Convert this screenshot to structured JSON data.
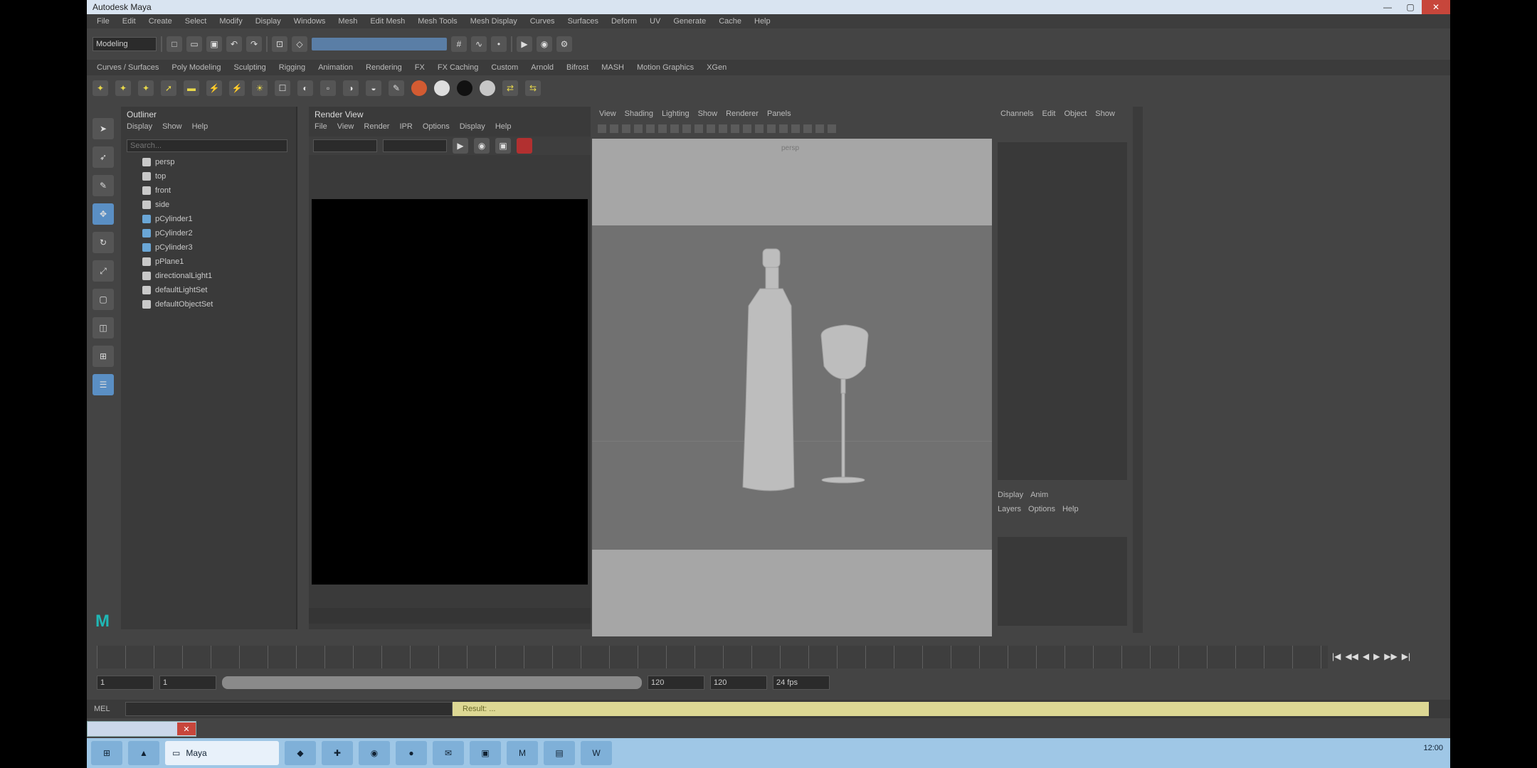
{
  "app": {
    "title": "Autodesk Maya",
    "title_bar_buttons": [
      "—",
      "▢",
      "✕"
    ]
  },
  "status_line": {
    "menus": [
      "File",
      "Edit",
      "Create",
      "Select",
      "Modify",
      "Display",
      "Windows",
      "Mesh",
      "Edit Mesh",
      "Mesh Tools",
      "Mesh Display",
      "Curves",
      "Surfaces",
      "Deform",
      "UV",
      "Generate",
      "Cache",
      "Help"
    ]
  },
  "toolrow": {
    "mode_selector": "Modeling"
  },
  "shelf_tabs": [
    "Curves / Surfaces",
    "Poly Modeling",
    "Sculpting",
    "Rigging",
    "Animation",
    "Rendering",
    "FX",
    "FX Caching",
    "Custom",
    "Arnold",
    "Bifrost",
    "MASH",
    "Motion Graphics",
    "XGen"
  ],
  "outliner": {
    "title": "Outliner",
    "menus": [
      "Display",
      "Show",
      "Help"
    ],
    "search_placeholder": "Search...",
    "items": [
      "persp",
      "top",
      "front",
      "side",
      "pCylinder1",
      "pCylinder2",
      "pCylinder3",
      "pPlane1",
      "directionalLight1",
      "defaultLightSet",
      "defaultObjectSet"
    ]
  },
  "render_view": {
    "title": "Render View",
    "menus": [
      "File",
      "View",
      "Render",
      "IPR",
      "Options",
      "Display",
      "Help"
    ]
  },
  "viewport": {
    "menus": [
      "View",
      "Shading",
      "Lighting",
      "Show",
      "Renderer",
      "Panels"
    ],
    "camera_label": "persp"
  },
  "channel_box": {
    "menus": [
      "Channels",
      "Edit",
      "Object",
      "Show"
    ],
    "layer_tabs": [
      "Display",
      "Anim"
    ],
    "layer_menus": [
      "Layers",
      "Options",
      "Help"
    ]
  },
  "time_slider": {
    "playback_glyphs": [
      "|◀",
      "◀◀",
      "◀",
      "▶",
      "▶▶",
      "▶|"
    ]
  },
  "range": {
    "start": "1",
    "end": "120",
    "fps": "24 fps"
  },
  "command_line": {
    "label": "MEL",
    "result": "Result: ..."
  },
  "taskbar": {
    "start_label": "⊞",
    "open_window": "Maya",
    "tray_time": "12:00"
  }
}
